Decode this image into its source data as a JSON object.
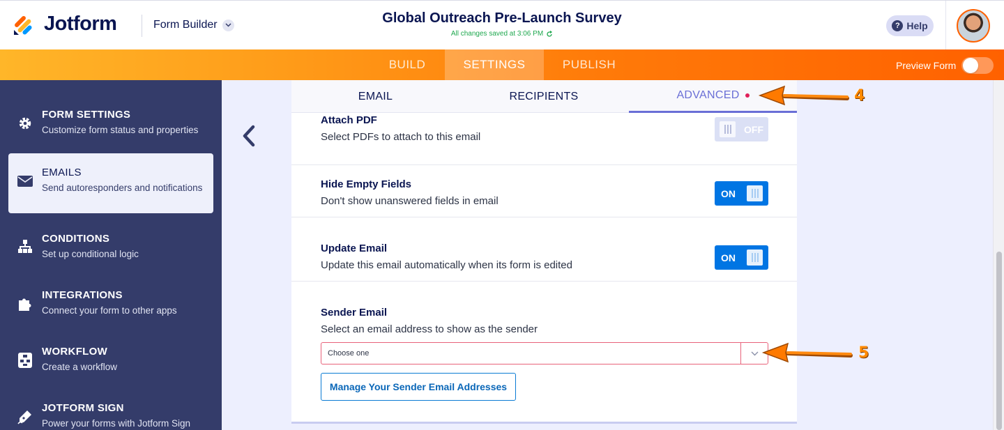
{
  "header": {
    "logo_text": "Jotform",
    "builder_label": "Form Builder",
    "form_title": "Global Outreach Pre-Launch Survey",
    "saved_status": "All changes saved at 3:06 PM",
    "help_label": "Help"
  },
  "nav": {
    "tabs": [
      {
        "label": "BUILD"
      },
      {
        "label": "SETTINGS",
        "active": true
      },
      {
        "label": "PUBLISH"
      }
    ],
    "preview_label": "Preview Form",
    "preview_on": false
  },
  "sidebar": {
    "items": [
      {
        "title": "FORM SETTINGS",
        "desc": "Customize form status and properties",
        "icon": "gear-icon"
      },
      {
        "title": "EMAILS",
        "desc": "Send autoresponders and notifications",
        "icon": "envelope-icon",
        "active": true
      },
      {
        "title": "CONDITIONS",
        "desc": "Set up conditional logic",
        "icon": "sitemap-icon"
      },
      {
        "title": "INTEGRATIONS",
        "desc": "Connect your form to other apps",
        "icon": "puzzle-icon"
      },
      {
        "title": "WORKFLOW",
        "desc": "Create a workflow",
        "icon": "workflow-icon"
      },
      {
        "title": "JOTFORM SIGN",
        "desc": "Power your forms with Jotform Sign",
        "icon": "pen-icon"
      }
    ]
  },
  "email_tabs": [
    {
      "label": "EMAIL"
    },
    {
      "label": "RECIPIENTS"
    },
    {
      "label": "ADVANCED",
      "active": true
    }
  ],
  "settings": {
    "attach_pdf": {
      "title": "Attach PDF",
      "desc": "Select PDFs to attach to this email",
      "state": "OFF"
    },
    "hide_empty": {
      "title": "Hide Empty Fields",
      "desc": "Don't show unanswered fields in email",
      "state": "ON"
    },
    "update_email": {
      "title": "Update Email",
      "desc": "Update this email automatically when its form is edited",
      "state": "ON"
    },
    "sender_email": {
      "title": "Sender Email",
      "desc": "Select an email address to show as the sender",
      "selected": "Choose one",
      "manage_label": "Manage Your Sender Email Addresses"
    }
  },
  "annotations": {
    "step_a": "4",
    "step_b": "5"
  },
  "colors": {
    "accent_orange": "#ff6100",
    "sidebar_bg": "#343c6a",
    "toggle_on": "#0075e3",
    "advanced_tab": "#6a6fd6"
  }
}
